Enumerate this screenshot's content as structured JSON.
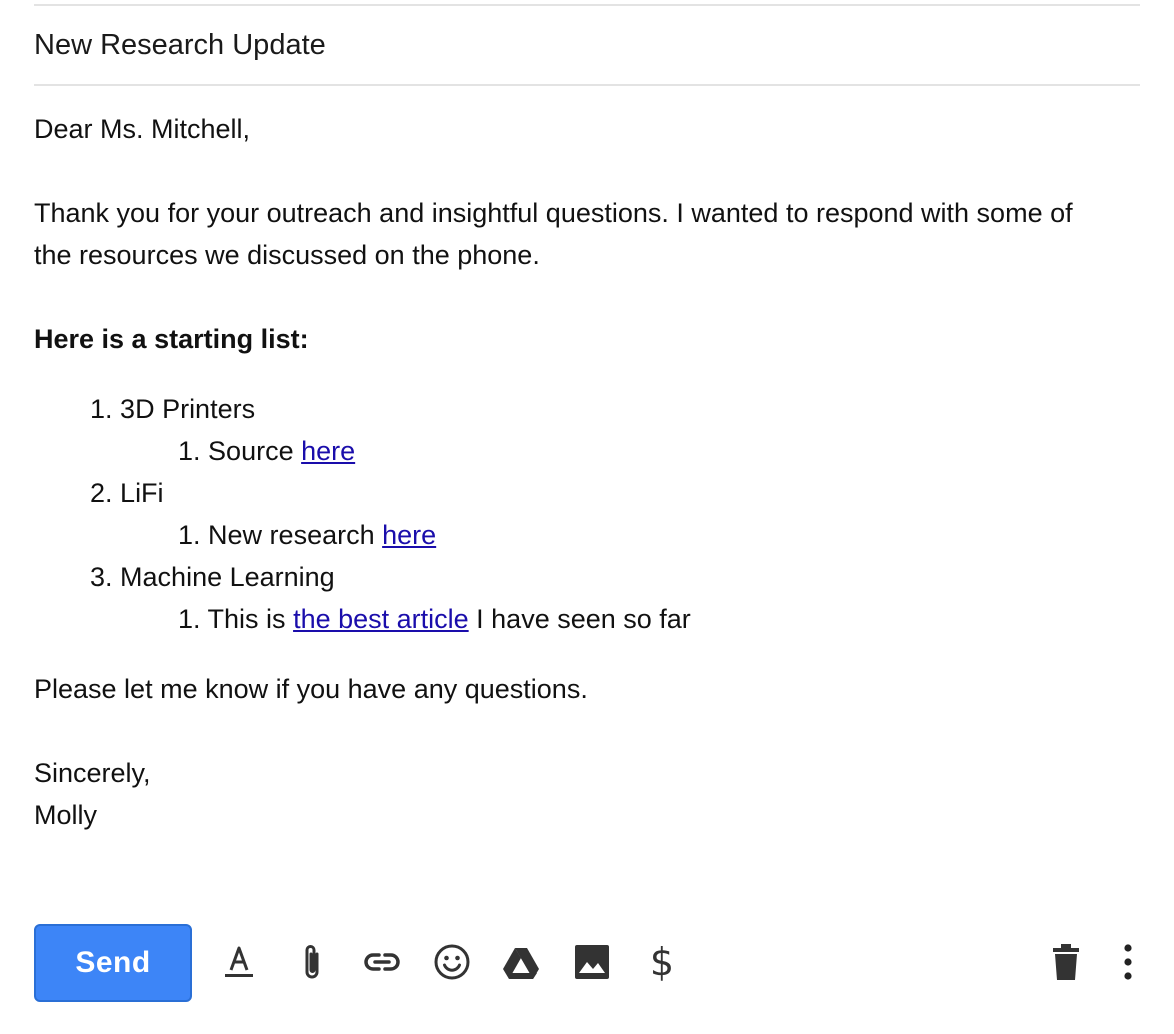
{
  "subject": "New Research Update",
  "greeting": "Dear Ms. Mitchell,",
  "intro": {
    "line1": "Thank you for your outreach and insightful questions. I wanted to respond with some of",
    "line2": "the resources we discussed on the phone."
  },
  "list_heading": "Here is a starting list:",
  "list": [
    {
      "number": "1.",
      "label": "3D Printers",
      "sub": {
        "number": "1.",
        "before": "Source ",
        "link": "here",
        "after": ""
      }
    },
    {
      "number": "2.",
      "label": "LiFi",
      "sub": {
        "number": "1.",
        "before": "New research ",
        "link": "here",
        "after": ""
      }
    },
    {
      "number": "3.",
      "label": "Machine Learning",
      "sub": {
        "number": "1.",
        "before": "This is ",
        "link": "the best article",
        "after": " I have seen so far"
      }
    }
  ],
  "closing_line": "Please let me know if you have any questions.",
  "signoff": "Sincerely,",
  "signature": "Molly",
  "toolbar": {
    "send_label": "Send",
    "dollar_symbol": "$",
    "icons": [
      "text-format-icon",
      "attach-icon",
      "link-icon",
      "emoji-icon",
      "drive-icon",
      "photo-icon",
      "money-icon",
      "trash-icon",
      "more-options-icon"
    ]
  },
  "colors": {
    "send_button": "#3d85f7",
    "link": "#1a0dab",
    "icon": "#333333"
  }
}
